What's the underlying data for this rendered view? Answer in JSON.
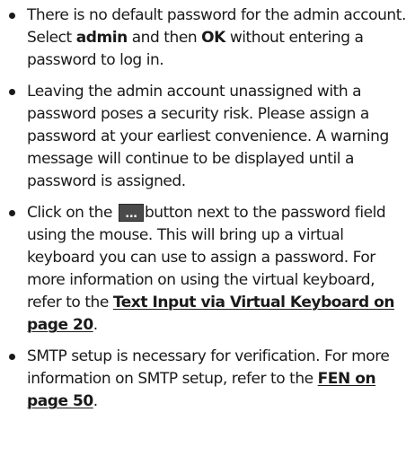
{
  "bullets": [
    {
      "segments": [
        {
          "text": "There is no default password for the admin account. Select ",
          "style": "normal"
        },
        {
          "text": "admin",
          "style": "bold"
        },
        {
          "text": " and then ",
          "style": "normal"
        },
        {
          "text": "OK",
          "style": "bold"
        },
        {
          "text": " without entering a password to log in.",
          "style": "normal"
        }
      ]
    },
    {
      "segments": [
        {
          "text": "Leaving the admin account unassigned with a password poses a security risk. Please assign a password at your earliest convenience. A warning message will continue to be displayed until a password is assigned.",
          "style": "normal"
        }
      ]
    },
    {
      "segments": [
        {
          "text": "Click on the ",
          "style": "normal"
        },
        {
          "text": "...",
          "style": "button"
        },
        {
          "text": "button next to the password field using the mouse. This will bring up a virtual keyboard you can use to assign a password. For more information on using the virtual keyboard, refer to the ",
          "style": "normal"
        },
        {
          "text": "Text Input via Virtual Keyboard on page 20",
          "style": "link"
        },
        {
          "text": ".",
          "style": "normal"
        }
      ]
    },
    {
      "segments": [
        {
          "text": "SMTP setup is necessary for verification. For more information on SMTP setup, refer to the ",
          "style": "normal"
        },
        {
          "text": "FEN on page 50",
          "style": "link"
        },
        {
          "text": ".",
          "style": "normal"
        }
      ]
    }
  ]
}
